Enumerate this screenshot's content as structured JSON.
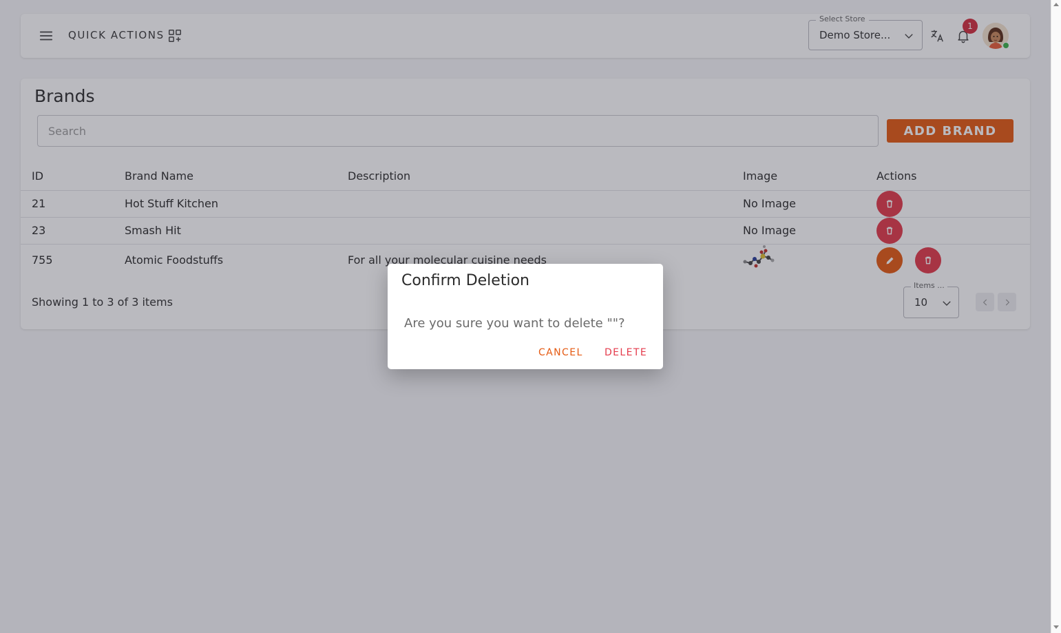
{
  "header": {
    "quick_actions_label": "QUICK ACTIONS",
    "store_select_legend": "Select Store",
    "store_select_value": "Demo Store...",
    "notification_count": "1"
  },
  "brands": {
    "title": "Brands",
    "search_placeholder": "Search",
    "add_button_label": "ADD BRAND",
    "columns": [
      "ID",
      "Brand Name",
      "Description",
      "Image",
      "Actions"
    ],
    "rows": [
      {
        "id": "21",
        "name": "Hot Stuff Kitchen",
        "description": "",
        "image": "No Image"
      },
      {
        "id": "23",
        "name": "Smash Hit",
        "description": "",
        "image": "No Image"
      },
      {
        "id": "755",
        "name": "Atomic Foodstuffs",
        "description": "For all your molecular cuisine needs",
        "image": ""
      }
    ],
    "footer_text": "Showing 1 to 3 of 3 items",
    "items_per_page_legend": "Items ...",
    "items_per_page_value": "10"
  },
  "dialog": {
    "title": "Confirm Deletion",
    "message": "Are you sure you want to delete \"\"?",
    "cancel_label": "CANCEL",
    "delete_label": "DELETE"
  },
  "colors": {
    "accent": "#e55a12",
    "danger": "#e43a4b",
    "badge": "#d32f3f"
  }
}
